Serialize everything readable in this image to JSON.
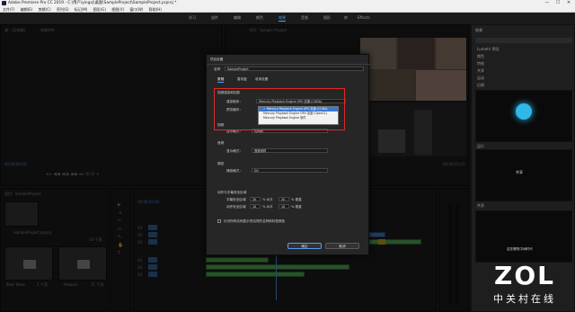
{
  "window": {
    "title": "Adobe Premiere Pro CC 2019 - C:\\用户\\yingxj\\桌面\\SampleProject\\SampleProject.prproj *",
    "min": "—",
    "max": "☐",
    "close": "✕"
  },
  "menu": [
    "文件(F)",
    "编辑(E)",
    "剪辑(C)",
    "序列(S)",
    "标记(M)",
    "图形(G)",
    "视图(V)",
    "窗口(W)",
    "帮助(H)"
  ],
  "workspaces": [
    "学习",
    "组件",
    "编辑",
    "颜色",
    "效果",
    "音频",
    "图形",
    "库",
    "Effects"
  ],
  "active_workspace": "效果",
  "source_panel": {
    "tab": "源：(无剪辑)",
    "tab2": "效果控件",
    "timecode": "00;00;00;00"
  },
  "program_panel": {
    "tab": "节目：Sample Project",
    "timecode_left": "00;00;00;00",
    "timecode_right": "00;00;11;07",
    "zoom": "适合"
  },
  "project_panel": {
    "tab": "项目：SampleProject",
    "file": "SampleProject.prproj",
    "count": "14 个项",
    "bins": [
      {
        "name": "Best Takes",
        "count": "1 个项"
      },
      {
        "name": "Helpers",
        "count": "11 个项"
      }
    ]
  },
  "timeline": {
    "timecode": "00;00;02;02",
    "ruler": [
      "00;00",
      "00;00;14;29",
      "00;00;29;29",
      "00;00;44;28",
      "00;01;00;00",
      "00;01;14;29",
      "00;01;29;29",
      "00;01;44;28",
      "00;02;00;00"
    ],
    "tracks": [
      "V3",
      "V2",
      "V1",
      "A1",
      "A2",
      "A3"
    ]
  },
  "right_panel": {
    "header": "效果",
    "lumetri": "Lumetri 预设",
    "items": [
      "颜色",
      "特效",
      "共享",
      "运动",
      "后期"
    ],
    "presets_title": "共享",
    "thumbs": [
      "运行",
      "",
      "共享",
      "这在哪的中间时代"
    ]
  },
  "dialog": {
    "title": "项目设置",
    "name_label": "名称",
    "name_value": "SampleProject",
    "tabs": [
      "常规",
      "暂存盘",
      "收录设置"
    ],
    "section_video": "视频渲染和回放",
    "renderer_label": "渲染程序：",
    "renderer_value": "Mercury Playback Engine GPU 加速 (CUDA)",
    "preview_label": "预览缓存：",
    "video_label": "视频",
    "display_format_label": "显示格式：",
    "display_format_value": "时间码",
    "audio_label": "音频",
    "audio_format_label": "显示格式：",
    "audio_format_value": "音频采样",
    "capture_label": "捕捉",
    "capture_format_label": "捕捉格式：",
    "capture_format_value": "DV",
    "motion_label": "动作与字幕安全区域",
    "title_safe_label": "字幕安全区域",
    "title_safe_value": "20",
    "title_safe_unit": "% 水平",
    "title_safe_v": "20",
    "title_safe_vunit": "% 垂直",
    "action_safe_label": "动作安全区域",
    "action_safe_value": "10",
    "action_safe_unit": "% 水平",
    "action_safe_v": "10",
    "action_safe_vunit": "% 垂直",
    "checkbox_label": "针对所有实例显示项目项的名称和标签颜色",
    "ok": "确定",
    "cancel": "取消"
  },
  "dropdown": {
    "items": [
      "Mercury Playback Engine GPU 加速 (CUDA)",
      "Mercury Playback Engine GPU 加速 (OpenCL)",
      "Mercury Playback Engine 软件"
    ],
    "selected": 0
  },
  "watermark": {
    "brand": "ZOL",
    "sub": "中关村在线"
  },
  "colors": {
    "accent": "#5a9bf0",
    "highlight": "#e02828",
    "clip_green": "#5bb35b",
    "clip_blue": "#4f7ecf"
  }
}
